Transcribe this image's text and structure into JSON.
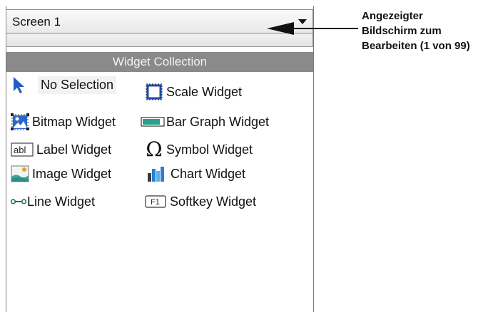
{
  "screen_select": {
    "value": "Screen 1"
  },
  "collection": {
    "title": "Widget Collection",
    "left_column": [
      {
        "label": "No Selection",
        "icon": "cursor-arrow-icon"
      },
      {
        "label": "Bitmap Widget",
        "icon": "bitmap-icon"
      },
      {
        "label": "Label Widget",
        "icon": "label-abl-icon"
      },
      {
        "label": "Image Widget",
        "icon": "image-icon"
      },
      {
        "label": "Line Widget",
        "icon": "line-icon"
      }
    ],
    "right_column": [
      {
        "label": "Scale Widget",
        "icon": "scale-icon"
      },
      {
        "label": "Bar Graph Widget",
        "icon": "bar-graph-icon"
      },
      {
        "label": "Symbol Widget",
        "icon": "omega-icon"
      },
      {
        "label": "Chart Widget",
        "icon": "chart-icon"
      },
      {
        "label": "Softkey Widget",
        "icon": "softkey-f1-icon"
      }
    ],
    "label_icon_text": "abl",
    "softkey_icon_text": "F1",
    "symbol_icon_glyph": "Ω"
  },
  "callout": {
    "lines": [
      "Angezeigter",
      "Bildschirm zum",
      "Bearbeiten (1 von 99)"
    ]
  }
}
